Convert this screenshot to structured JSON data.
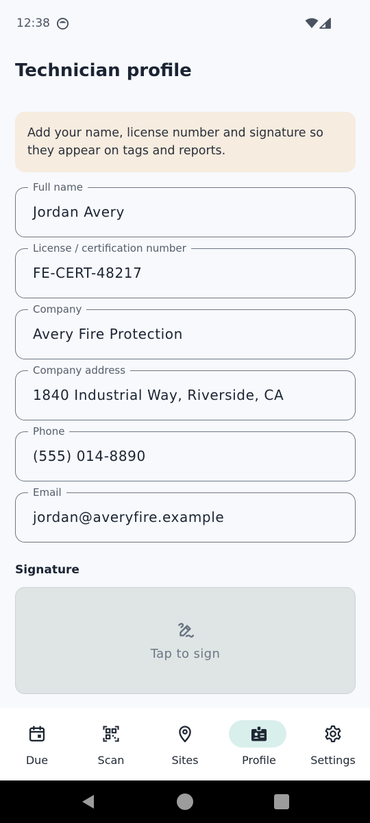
{
  "status_bar": {
    "time": "12:38",
    "icons": [
      "app-notification-icon",
      "wifi-icon",
      "signal-icon"
    ]
  },
  "page": {
    "title": "Technician profile"
  },
  "banner": {
    "text": "Add your name, license number and signature so they appear on tags and reports."
  },
  "fields": [
    {
      "label": "Full name",
      "value": "Jordan Avery"
    },
    {
      "label": "License / certification number",
      "value": "FE-CERT-48217"
    },
    {
      "label": "Company",
      "value": "Avery Fire Protection"
    },
    {
      "label": "Company address",
      "value": "1840 Industrial Way, Riverside, CA"
    },
    {
      "label": "Phone",
      "value": "(555) 014-8890"
    },
    {
      "label": "Email",
      "value": "jordan@averyfire.example"
    }
  ],
  "signature": {
    "label": "Signature",
    "hint": "Tap to sign",
    "icon": "draw-icon"
  },
  "bottom_nav": {
    "items": [
      {
        "label": "Due",
        "icon": "calendar-icon",
        "active": false
      },
      {
        "label": "Scan",
        "icon": "qr-scan-icon",
        "active": false
      },
      {
        "label": "Sites",
        "icon": "location-pin-icon",
        "active": false
      },
      {
        "label": "Profile",
        "icon": "badge-icon",
        "active": true
      },
      {
        "label": "Settings",
        "icon": "gear-icon",
        "active": false
      }
    ]
  },
  "colors": {
    "accent_pill": "#d9efec",
    "banner_bg": "#f6ecdf",
    "signature_bg": "#dfe5e4"
  }
}
